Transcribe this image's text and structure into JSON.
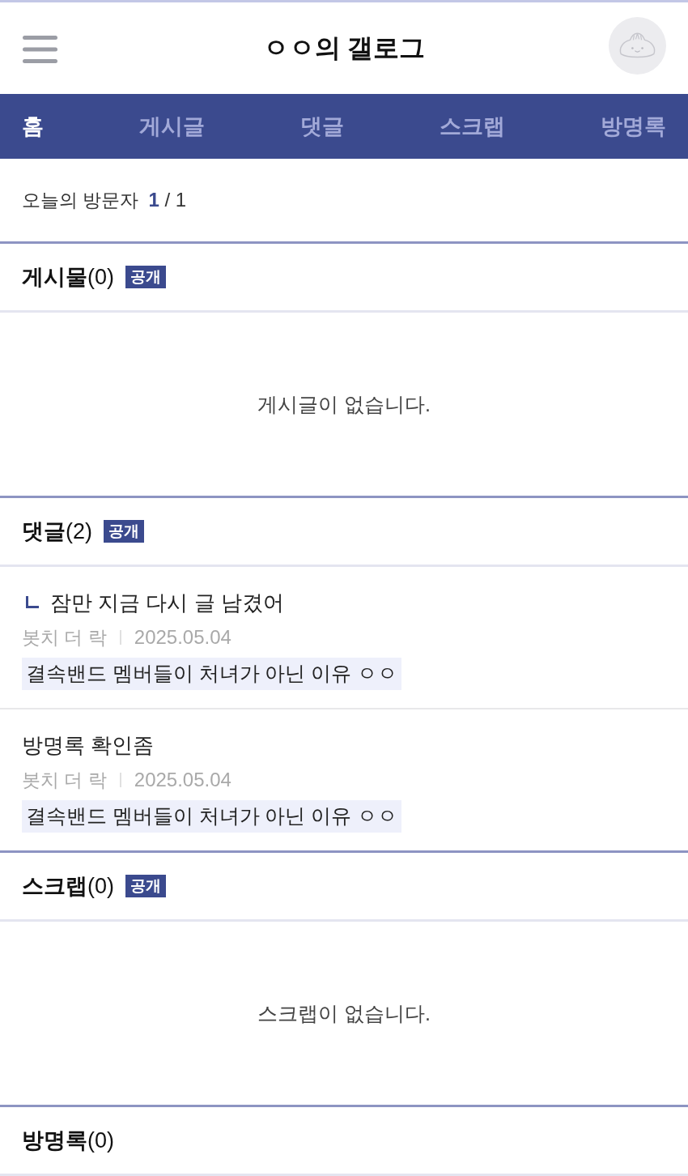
{
  "header": {
    "title": "ㅇㅇ의 갤로그"
  },
  "tabs": [
    {
      "label": "홈",
      "selected": true
    },
    {
      "label": "게시글",
      "selected": false
    },
    {
      "label": "댓글",
      "selected": false
    },
    {
      "label": "스크랩",
      "selected": false
    },
    {
      "label": "방명록",
      "selected": false
    }
  ],
  "visitors": {
    "label": "오늘의 방문자",
    "count": "**1** / 1"
  },
  "sections": [
    {
      "heading": "**게시물**(0)",
      "badge": "공개",
      "kind": "empty",
      "empty_text": "게시글이 없습니다."
    },
    {
      "heading": "**댓글**(2)",
      "badge": "공개",
      "kind": "comments",
      "comments": [
        {
          "reply": true,
          "text": "잠만 지금 다시 글 남겼어",
          "author": "봇치 더 락",
          "date": "2025.05.04",
          "post": "결속밴드 멤버들이 처녀가 아닌 이유 ㅇㅇ"
        },
        {
          "reply": false,
          "text": "방명록 확인좀",
          "author": "봇치 더 락",
          "date": "2025.05.04",
          "post": "결속밴드 멤버들이 처녀가 아닌 이유 ㅇㅇ"
        }
      ]
    },
    {
      "heading": "**스크랩**(0)",
      "badge": "공개",
      "kind": "empty",
      "empty_text": "스크랩이 없습니다."
    },
    {
      "heading": "**방명록**(0)"
    }
  ]
}
